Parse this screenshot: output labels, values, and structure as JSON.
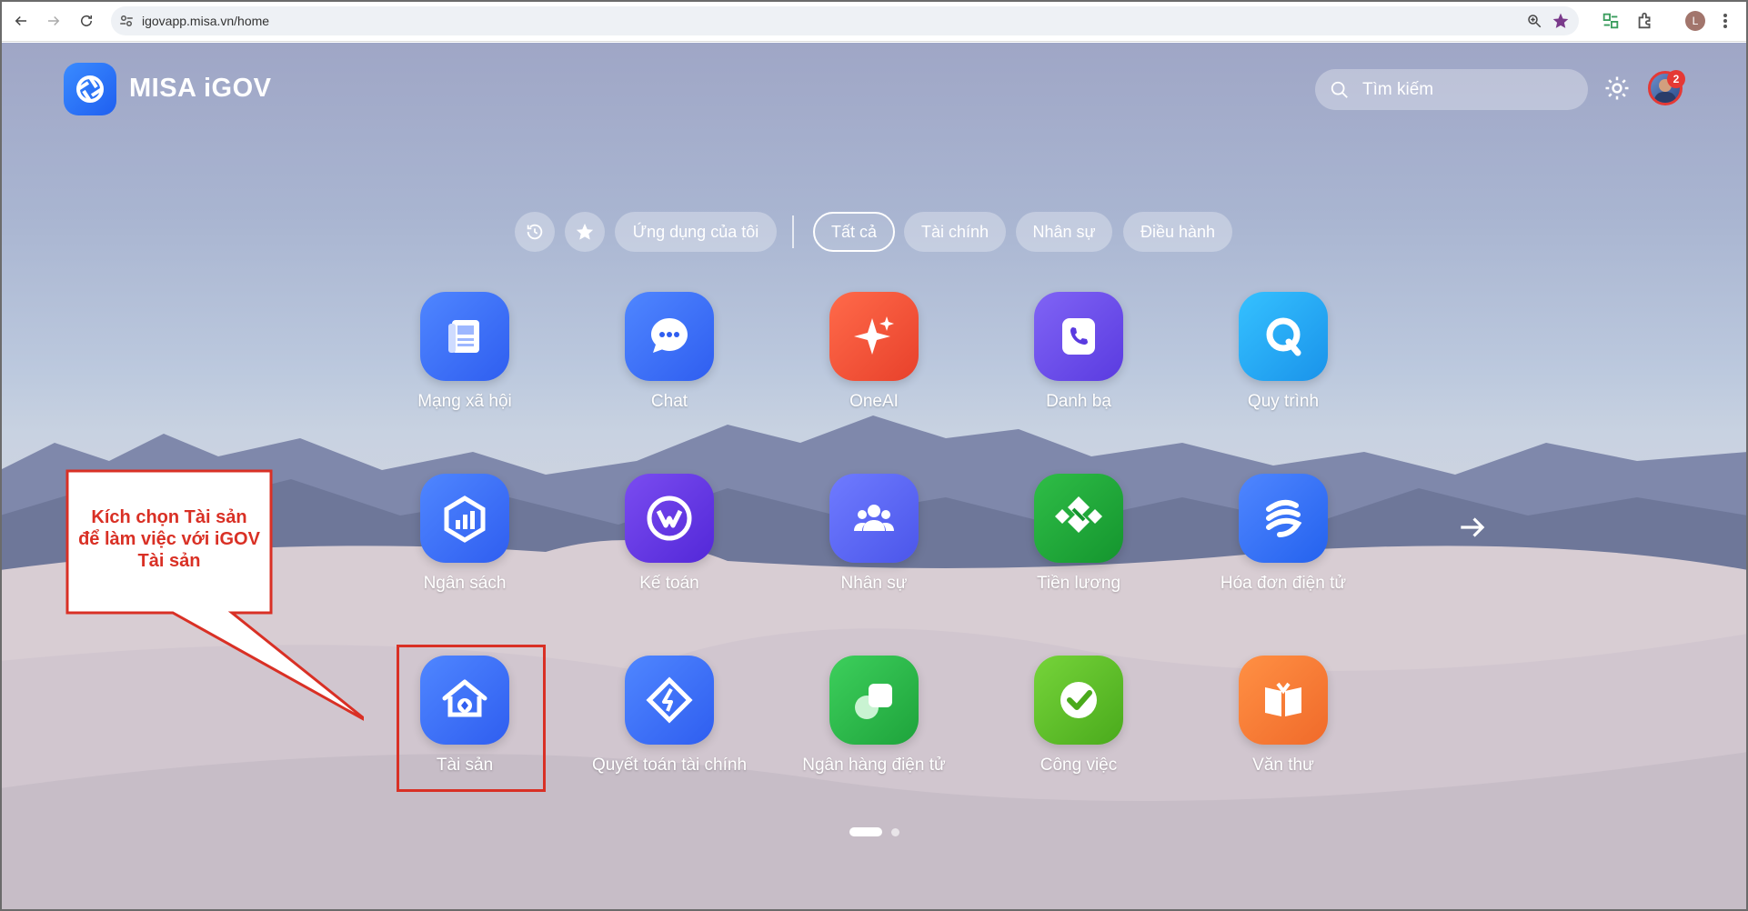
{
  "browser": {
    "url": "igovapp.misa.vn/home",
    "profile_initial": "L"
  },
  "header": {
    "brand": "MISA iGOV",
    "search_placeholder": "Tìm kiếm",
    "notification_count": "2"
  },
  "filters": {
    "my_apps": "Ứng dụng của tôi",
    "all": "Tất cả",
    "finance": "Tài chính",
    "hr": "Nhân sự",
    "operations": "Điều hành",
    "active": "Tất cả"
  },
  "apps": [
    {
      "label": "Mạng xã hội",
      "icon": "newspaper-icon",
      "color": "#3a6ff7"
    },
    {
      "label": "Chat",
      "icon": "chat-bubble-icon",
      "color": "#3a6ff7"
    },
    {
      "label": "OneAI",
      "icon": "sparkle-icon",
      "color": "#f1503a"
    },
    {
      "label": "Danh bạ",
      "icon": "phone-icon",
      "color": "#6a4be8"
    },
    {
      "label": "Quy trình",
      "icon": "q-ring-icon",
      "color": "#23a9f2"
    },
    {
      "label": "Ngân sách",
      "icon": "budget-chart-icon",
      "color": "#3a6ff7"
    },
    {
      "label": "Kế toán",
      "icon": "accounting-icon",
      "color": "#6a3be8"
    },
    {
      "label": "Nhân sự",
      "icon": "people-icon",
      "color": "#5a66f2"
    },
    {
      "label": "Tiền lương",
      "icon": "salary-icon",
      "color": "#1ea53a"
    },
    {
      "label": "Hóa đơn điện tử",
      "icon": "invoice-icon",
      "color": "#2e72f5"
    },
    {
      "label": "Tài sản",
      "icon": "house-icon",
      "color": "#3a6ff7"
    },
    {
      "label": "Quyết toán tài chính",
      "icon": "settlement-icon",
      "color": "#3a6ff7"
    },
    {
      "label": "Ngân hàng điện tử",
      "icon": "ebank-icon",
      "color": "#29b84a"
    },
    {
      "label": "Công việc",
      "icon": "check-icon",
      "color": "#5fbf2a"
    },
    {
      "label": "Văn thư",
      "icon": "book-icon",
      "color": "#f57b3a"
    }
  ],
  "annotation": {
    "text": "Kích chọn Tài sản để làm việc với iGOV Tài sản"
  },
  "pager": {
    "pages": 2,
    "current": 1
  }
}
